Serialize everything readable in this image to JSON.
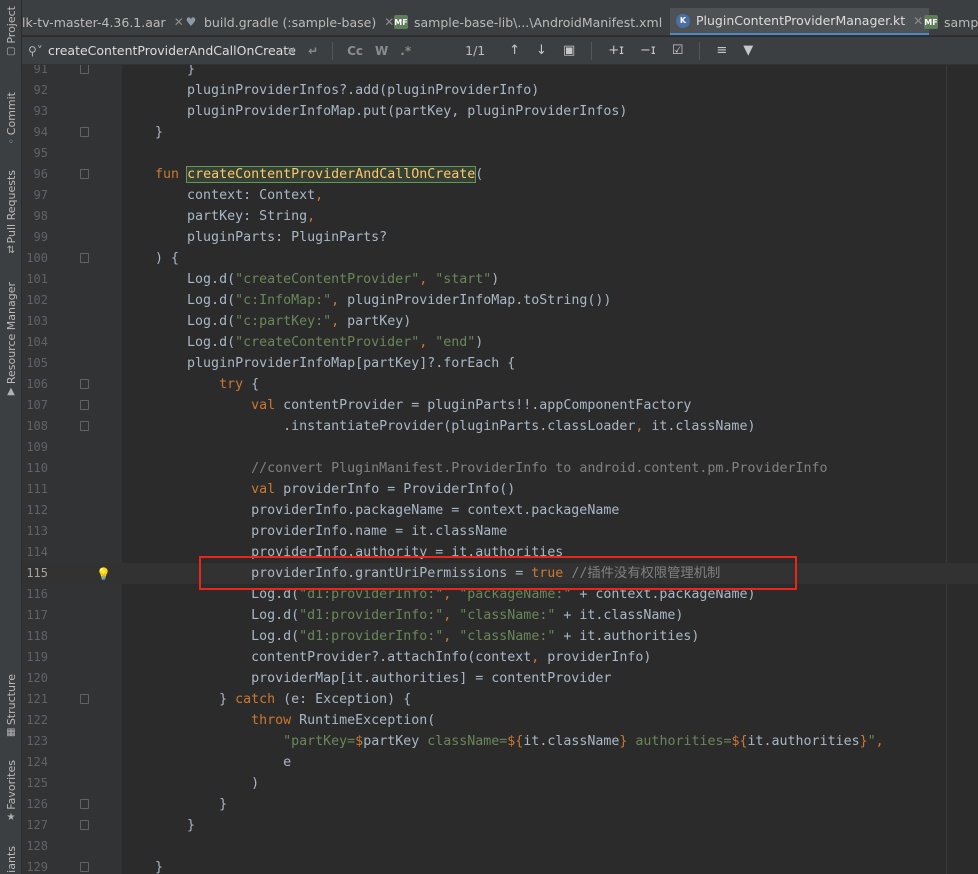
{
  "side_tabs": [
    {
      "label": "Project",
      "icon": "folder-icon"
    },
    {
      "label": "Commit",
      "icon": "commit-icon"
    },
    {
      "label": "Pull Requests",
      "icon": "pull-request-icon"
    },
    {
      "label": "Resource Manager",
      "icon": "resource-icon"
    },
    {
      "label": "Structure",
      "icon": "structure-icon"
    },
    {
      "label": "Favorites",
      "icon": "star-icon"
    },
    {
      "label": "iants",
      "icon": ""
    }
  ],
  "tabs": [
    {
      "label": "lk-tv-master-4.36.1.aar",
      "icon": "",
      "active": false
    },
    {
      "label": "build.gradle (:sample-base)",
      "icon": "gradle-icon",
      "active": false
    },
    {
      "label": "sample-base-lib\\...\\AndroidManifest.xml",
      "icon": "manifest-icon",
      "active": false
    },
    {
      "label": "PluginContentProviderManager.kt",
      "icon": "kotlin-icon",
      "active": true
    },
    {
      "label": "sampl",
      "icon": "manifest-icon",
      "active": false
    }
  ],
  "search": {
    "query": "createContentProviderAndCallOnCreate",
    "match_case": "Cc",
    "words": "W",
    "count": "1/1"
  },
  "lines": [
    {
      "n": "91",
      "html": "        }"
    },
    {
      "n": "92",
      "html": "        pluginProviderInfos?.add(pluginProviderInfo)"
    },
    {
      "n": "93",
      "html": "        pluginProviderInfoMap.put(partKey, pluginProviderInfos)"
    },
    {
      "n": "94",
      "html": "    }"
    },
    {
      "n": "95",
      "html": ""
    },
    {
      "n": "96",
      "html": "    <span class='k'>fun</span> <span class='fn-hl'>createContentProviderAndCallOnCreate</span>("
    },
    {
      "n": "97",
      "html": "        context: Context<span class='k'>,</span>"
    },
    {
      "n": "98",
      "html": "        partKey: String<span class='k'>,</span>"
    },
    {
      "n": "99",
      "html": "        pluginParts: PluginParts?"
    },
    {
      "n": "100",
      "html": "    ) {"
    },
    {
      "n": "101",
      "html": "        Log.d(<span class='s'>\"createContentProvider\"</span><span class='k'>,</span> <span class='s'>\"start\"</span>)"
    },
    {
      "n": "102",
      "html": "        Log.d(<span class='s'>\"c:InfoMap:\"</span><span class='k'>,</span> pluginProviderInfoMap.toString())"
    },
    {
      "n": "103",
      "html": "        Log.d(<span class='s'>\"c:partKey:\"</span><span class='k'>,</span> partKey)"
    },
    {
      "n": "104",
      "html": "        Log.d(<span class='s'>\"createContentProvider\"</span><span class='k'>,</span> <span class='s'>\"end\"</span>)"
    },
    {
      "n": "105",
      "html": "        pluginProviderInfoMap[partKey]?.forEach {"
    },
    {
      "n": "106",
      "html": "            <span class='k'>try</span> {"
    },
    {
      "n": "107",
      "html": "                <span class='k'>val</span> contentProvider = pluginParts!!.appComponentFactory"
    },
    {
      "n": "108",
      "html": "                    .instantiateProvider(pluginParts.classLoader<span class='k'>,</span> it.className)"
    },
    {
      "n": "109",
      "html": ""
    },
    {
      "n": "110",
      "html": "                <span class='c'>//convert PluginManifest.ProviderInfo to android.content.pm.ProviderInfo</span>"
    },
    {
      "n": "111",
      "html": "                <span class='k'>val</span> providerInfo = ProviderInfo()"
    },
    {
      "n": "112",
      "html": "                providerInfo.packageName = context.packageName"
    },
    {
      "n": "113",
      "html": "                providerInfo.name = it.className"
    },
    {
      "n": "114",
      "html": "                providerInfo.authority = it.authorities"
    },
    {
      "n": "115",
      "html": "                providerInfo.grantUriPermissions = <span class='k'>true</span> <span class='c'>//插件没有权限管理机制</span>"
    },
    {
      "n": "116",
      "html": "                Log.d(<span class='s'>\"d1:providerInfo:\"</span><span class='k'>,</span> <span class='s'>\"packageName:\"</span> + context.packageName)"
    },
    {
      "n": "117",
      "html": "                Log.d(<span class='s'>\"d1:providerInfo:\"</span><span class='k'>,</span> <span class='s'>\"className:\"</span> + it.className)"
    },
    {
      "n": "118",
      "html": "                Log.d(<span class='s'>\"d1:providerInfo:\"</span><span class='k'>,</span> <span class='s'>\"className:\"</span> + it.authorities)"
    },
    {
      "n": "119",
      "html": "                contentProvider?.attachInfo(context<span class='k'>,</span> providerInfo)"
    },
    {
      "n": "120",
      "html": "                providerMap[it.authorities] = contentProvider"
    },
    {
      "n": "121",
      "html": "            } <span class='k'>catch</span> (e: Exception) {"
    },
    {
      "n": "122",
      "html": "                <span class='k'>throw</span> RuntimeException("
    },
    {
      "n": "123",
      "html": "                    <span class='s'>\"partKey=</span><span class='k'>$</span>partKey <span class='s'>className=</span><span class='k'>${</span>it.className<span class='k'>}</span> <span class='s'>authorities=</span><span class='k'>${</span>it.authorities<span class='k'>}</span><span class='s'>\"</span><span class='k'>,</span>"
    },
    {
      "n": "124",
      "html": "                    e"
    },
    {
      "n": "125",
      "html": "                )"
    },
    {
      "n": "126",
      "html": "            }"
    },
    {
      "n": "127",
      "html": "        }"
    },
    {
      "n": "128",
      "html": ""
    },
    {
      "n": "129",
      "html": "    }"
    }
  ],
  "current_line": "115",
  "colors": {
    "keyword": "#cc7832",
    "string": "#6a8759",
    "comment": "#808080",
    "highlight_box": "#e8261c",
    "tab_accent": "#4a88c7"
  }
}
